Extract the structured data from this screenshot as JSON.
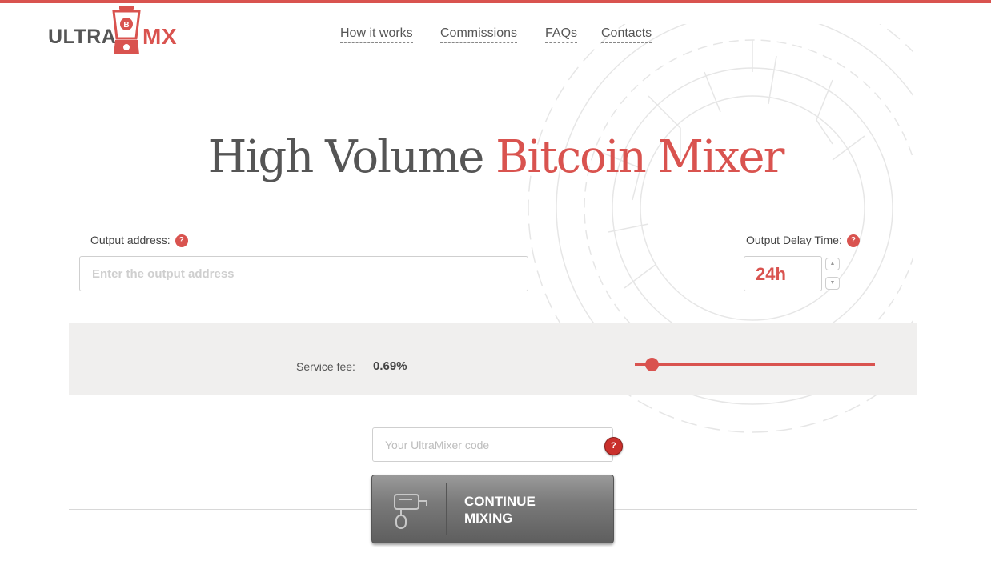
{
  "brand": {
    "logo_part1": "ULTRA",
    "logo_part2": "MX",
    "accent_color": "#d9534f"
  },
  "nav": {
    "items": [
      {
        "label": "How it works"
      },
      {
        "label": "Commissions"
      },
      {
        "label": "FAQs"
      },
      {
        "label": "Contacts"
      }
    ]
  },
  "hero": {
    "title_part1": "High Volume",
    "title_part2": "Bitcoin Mixer"
  },
  "form": {
    "output_address_label": "Output address:",
    "output_address_placeholder": "Enter the output address",
    "delay_label": "Output Delay Time:",
    "delay_value": "24h",
    "help_glyph": "?",
    "spin_up_glyph": "▲",
    "spin_down_glyph": "▼"
  },
  "fee": {
    "label": "Service fee:",
    "value": "0.69%",
    "slider_fraction": 0.07
  },
  "code": {
    "placeholder": "Your UltraMixer code"
  },
  "cta": {
    "line1": "CONTINUE",
    "line2": "MIXING"
  },
  "icons": [
    "blender-logo-icon",
    "help-icon",
    "mixer-icon",
    "spin-up-icon",
    "spin-down-icon"
  ]
}
